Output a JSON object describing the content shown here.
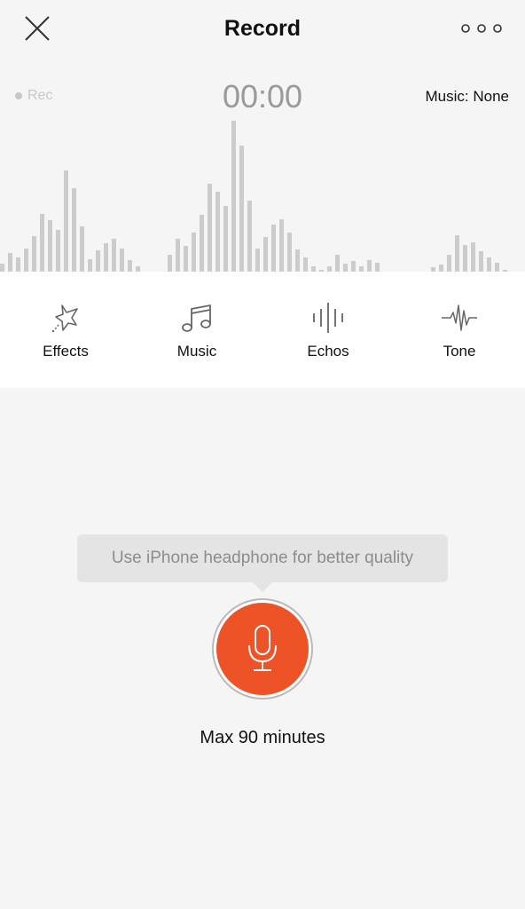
{
  "nav": {
    "title": "Record",
    "close_icon": "close-icon",
    "more_icon": "more-horizontal-icon"
  },
  "status": {
    "rec_label": "Rec",
    "timer": "00:00",
    "music": "Music: None"
  },
  "waveform": {
    "bar_color": "#cccccc",
    "max_level": 170,
    "levels": [
      9,
      21,
      16,
      26,
      40,
      65,
      58,
      47,
      114,
      94,
      51,
      14,
      24,
      32,
      37,
      26,
      13,
      6,
      0,
      0,
      0,
      19,
      37,
      29,
      44,
      64,
      99,
      90,
      74,
      170,
      142,
      80,
      26,
      39,
      53,
      59,
      44,
      25,
      16,
      6,
      2,
      6,
      19,
      9,
      12,
      6,
      13,
      10,
      0,
      0,
      0,
      0,
      0,
      0,
      5,
      8,
      19,
      41,
      30,
      33,
      23,
      16,
      10,
      2
    ]
  },
  "toolbar": {
    "items": [
      {
        "label": "Effects",
        "icon": "magic-star-icon"
      },
      {
        "label": "Music",
        "icon": "music-note-icon"
      },
      {
        "label": "Echos",
        "icon": "echo-bars-icon"
      },
      {
        "label": "Tone",
        "icon": "waveform-tone-icon"
      }
    ]
  },
  "tooltip": {
    "text": "Use iPhone headphone for better quality"
  },
  "record": {
    "accent": "#ee5328",
    "icon": "microphone-icon",
    "max_label": "Max 90 minutes"
  }
}
